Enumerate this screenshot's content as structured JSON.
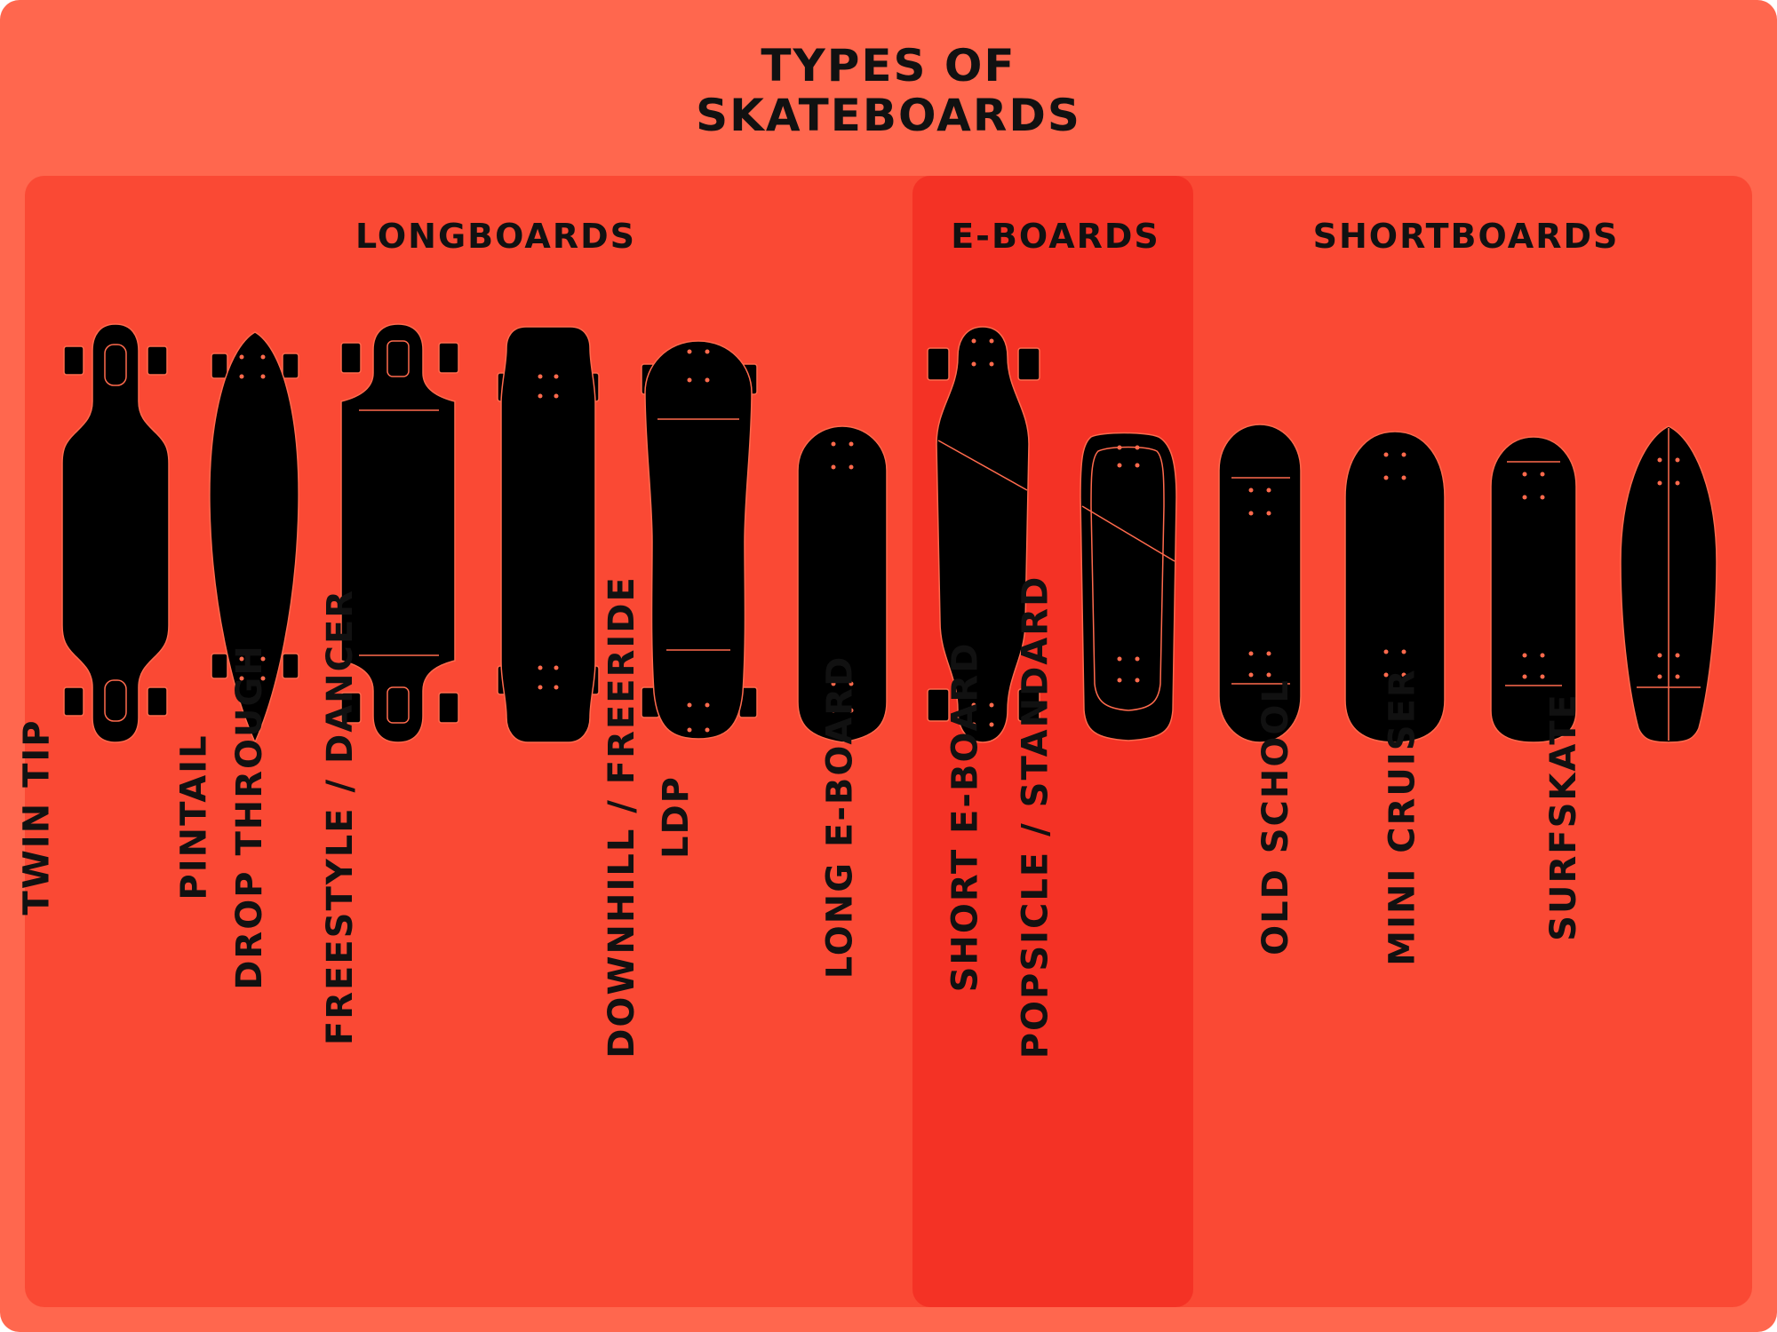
{
  "title_line1": "TYPES OF",
  "title_line2": "SKATEBOARDS",
  "groups": [
    {
      "id": "longboards",
      "label": "LONGBOARDS"
    },
    {
      "id": "eboards",
      "label": "E-BOARDS"
    },
    {
      "id": "shortboards",
      "label": "SHORTBOARDS"
    }
  ],
  "boards": [
    {
      "label": "TWIN TIP",
      "group": "longboards",
      "icon": "twin-tip-deck-icon"
    },
    {
      "label": "PINTAIL",
      "group": "longboards",
      "icon": "pintail-deck-icon"
    },
    {
      "label": "DROP THROUGH",
      "group": "longboards",
      "icon": "drop-through-deck-icon"
    },
    {
      "label": "FREESTYLE / DANCER",
      "group": "longboards",
      "icon": "freestyle-dancer-deck-icon"
    },
    {
      "label": "LDP",
      "group": "longboards",
      "icon": "ldp-deck-icon"
    },
    {
      "label": "DOWNHILL / FREERIDE",
      "group": "longboards",
      "icon": "downhill-freeride-deck-icon"
    },
    {
      "label": "LONG E-BOARD",
      "group": "eboards",
      "icon": "long-eboard-deck-icon"
    },
    {
      "label": "SHORT E-BOARD",
      "group": "eboards",
      "icon": "short-eboard-deck-icon"
    },
    {
      "label": "POPSICLE / STANDARD",
      "group": "shortboards",
      "icon": "popsicle-standard-deck-icon"
    },
    {
      "label": "OLD SCHOOL",
      "group": "shortboards",
      "icon": "old-school-deck-icon"
    },
    {
      "label": "MINI CRUISER",
      "group": "shortboards",
      "icon": "mini-cruiser-deck-icon"
    },
    {
      "label": "SURFSKATE",
      "group": "shortboards",
      "icon": "surfskate-deck-icon"
    }
  ],
  "colors": {
    "background": "#FF674E",
    "panel": "#FA4934",
    "eboards_panel": "#F43225",
    "deck": "#000000",
    "accent": "#FF6A4D",
    "text": "#111111"
  }
}
